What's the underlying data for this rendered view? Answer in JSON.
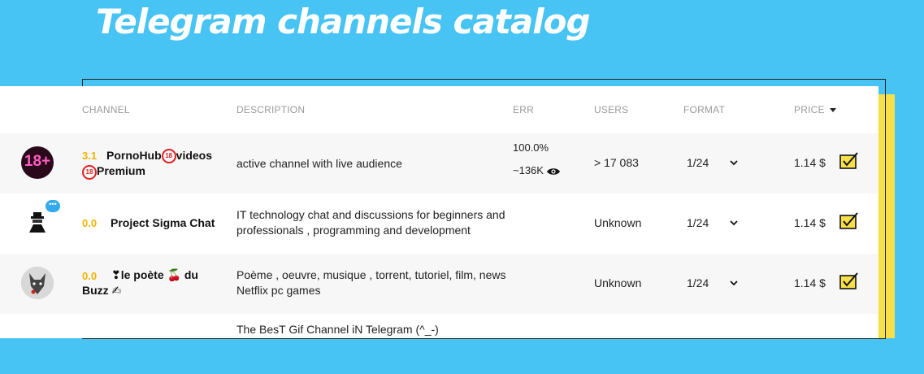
{
  "page": {
    "title": "Telegram channels catalog"
  },
  "table": {
    "headers": {
      "channel": "CHANNEL",
      "description": "DESCRIPTION",
      "err": "ERR",
      "users": "USERS",
      "format": "FORMAT",
      "price": "PRICE"
    },
    "rows": [
      {
        "avatar_text": "18+",
        "rating": "3.1",
        "name_part1": "PornoHub",
        "name_badge": "18",
        "name_part2": "videos",
        "name_part3": "Premium",
        "description": "active channel with live audience",
        "err_percent": "100.0%",
        "err_views": "~136K",
        "users": "> 17 083",
        "format": "1/24",
        "price": "1.14 $"
      },
      {
        "avatar_bubble": "•••",
        "rating": "0.0",
        "name": "Project Sigma Chat",
        "description": "IT technology chat and discussions for beginners and professionals , programming and development",
        "users": "Unknown",
        "format": "1/24",
        "price": "1.14 $"
      },
      {
        "rating": "0.0",
        "name_part1": "❣le poète",
        "name_part2": "🍒 du",
        "name_part3": "Buzz ✍",
        "description": "Poème , oeuvre, musique , torrent, tutoriel, film, news Netflix pc games",
        "users": "Unknown",
        "format": "1/24",
        "price": "1.14 $"
      },
      {
        "description": "The BesT Gif Channel iN Telegram (^_-)"
      }
    ]
  },
  "colors": {
    "background": "#47c4f4",
    "accent_yellow": "#f7df4a",
    "rating_color": "#f0b400"
  }
}
